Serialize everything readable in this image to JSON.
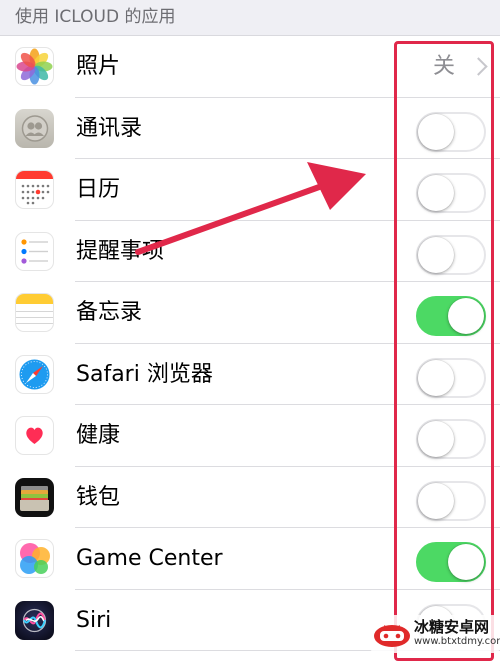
{
  "section_header": "使用 ICLOUD 的应用",
  "rows": [
    {
      "label": "照片",
      "icon": "photos-icon",
      "value": "关",
      "type": "disclosure"
    },
    {
      "label": "通讯录",
      "icon": "contacts-icon",
      "type": "toggle",
      "on": false
    },
    {
      "label": "日历",
      "icon": "calendar-icon",
      "type": "toggle",
      "on": false
    },
    {
      "label": "提醒事项",
      "icon": "reminders-icon",
      "type": "toggle",
      "on": false
    },
    {
      "label": "备忘录",
      "icon": "notes-icon",
      "type": "toggle",
      "on": true
    },
    {
      "label": "Safari 浏览器",
      "icon": "safari-icon",
      "type": "toggle",
      "on": false
    },
    {
      "label": "健康",
      "icon": "health-icon",
      "type": "toggle",
      "on": false
    },
    {
      "label": "钱包",
      "icon": "wallet-icon",
      "type": "toggle",
      "on": false
    },
    {
      "label": "Game Center",
      "icon": "game-center-icon",
      "type": "toggle",
      "on": true
    },
    {
      "label": "Siri",
      "icon": "siri-icon",
      "type": "toggle",
      "on": false
    }
  ],
  "watermark": {
    "title": "冰糖安卓网",
    "url": "www.btxtdmy.com"
  },
  "colors": {
    "toggle_on": "#4cd964",
    "annotation": "#e0284a",
    "group_bg": "#efeff4"
  }
}
